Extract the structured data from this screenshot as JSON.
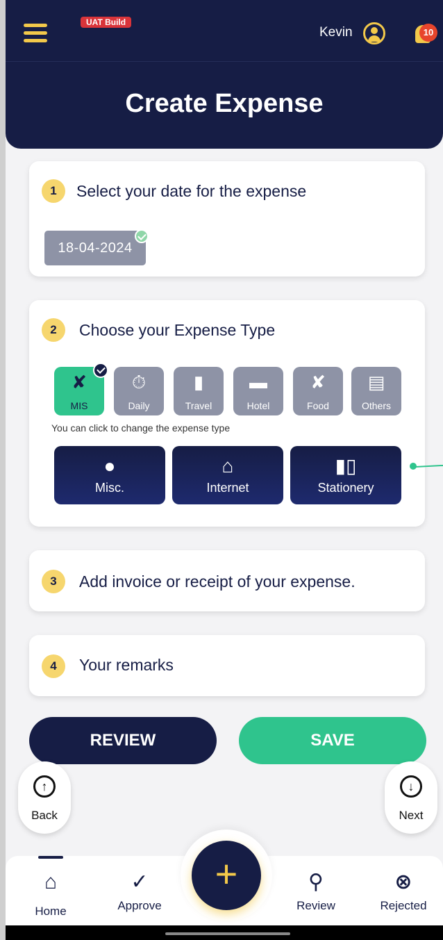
{
  "header": {
    "build_badge": "UAT Build",
    "user_name": "Kevin",
    "notification_count": "10",
    "title": "Create Expense",
    "accent_color": "#f3c94a",
    "bg_color": "#161d45"
  },
  "steps": [
    {
      "num": "1",
      "title": "Select your date for the expense"
    },
    {
      "num": "2",
      "title": "Choose your Expense Type"
    },
    {
      "num": "3",
      "title": "Add invoice or receipt of your expense."
    },
    {
      "num": "4",
      "title": "Your remarks"
    }
  ],
  "date_value": "18-04-2024",
  "expense_types": [
    {
      "label": "MIS",
      "icon": "cutlery-icon",
      "selected": true
    },
    {
      "label": "Daily",
      "icon": "runner-clock-icon",
      "selected": false
    },
    {
      "label": "Travel",
      "icon": "luggage-icon",
      "selected": false
    },
    {
      "label": "Hotel",
      "icon": "bed-icon",
      "selected": false
    },
    {
      "label": "Food",
      "icon": "cutlery-icon",
      "selected": false
    },
    {
      "label": "Others",
      "icon": "receipt-icon",
      "selected": false
    }
  ],
  "type_hint": "You can click to change the expense type",
  "sub_types": [
    {
      "label": "Misc.",
      "icon": "circle-icon"
    },
    {
      "label": "Internet",
      "icon": "router-icon"
    },
    {
      "label": "Stationery",
      "icon": "pencil-ruler-icon"
    }
  ],
  "actions": {
    "review": "REVIEW",
    "save": "SAVE"
  },
  "float_nav": {
    "back": "Back",
    "next": "Next"
  },
  "bottom_nav": {
    "home": "Home",
    "approve": "Approve",
    "review": "Review",
    "rejected": "Rejected"
  },
  "colors": {
    "success": "#2fc48d",
    "muted_tile": "#8e93a6",
    "step_badge": "#f6d66e"
  }
}
